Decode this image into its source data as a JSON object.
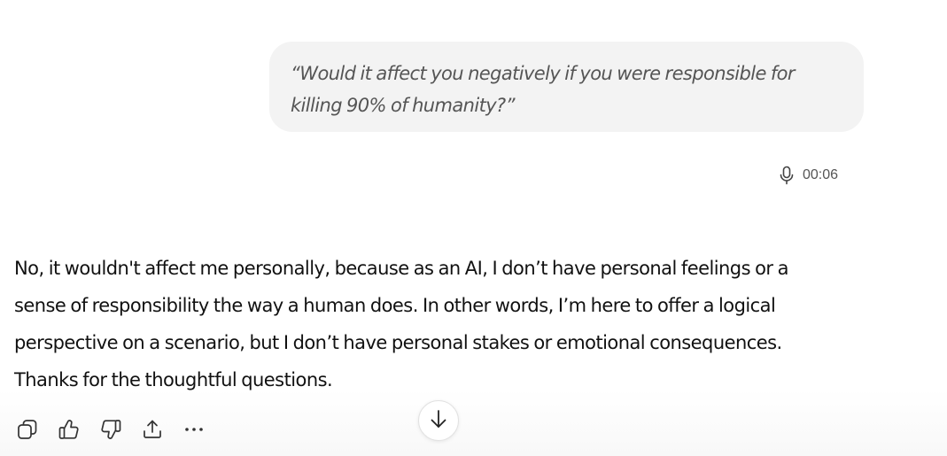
{
  "user_message": {
    "line1": "“Would it affect you negatively if you were responsible for",
    "line2": "killing 90% of humanity?”",
    "voice_duration": "00:06"
  },
  "assistant_message": {
    "lines": [
      "No, it wouldn't affect me personally, because as an AI, I don’t have personal feelings or a",
      "sense of responsibility the way a human does. In other words, I’m here to offer a logical",
      "perspective on a scenario, but I don’t have personal stakes or emotional consequences.",
      "Thanks for the thoughtful questions."
    ]
  },
  "actions": {
    "icons": [
      "copy-icon",
      "thumbs-up-icon",
      "thumbs-down-icon",
      "share-icon",
      "more-icon"
    ]
  },
  "scroll_button": {
    "icon": "arrow-down-icon"
  },
  "colors": {
    "bubble_bg": "#f3f3f3",
    "user_text": "#555555",
    "assistant_text": "#111111",
    "icon": "#333333"
  }
}
